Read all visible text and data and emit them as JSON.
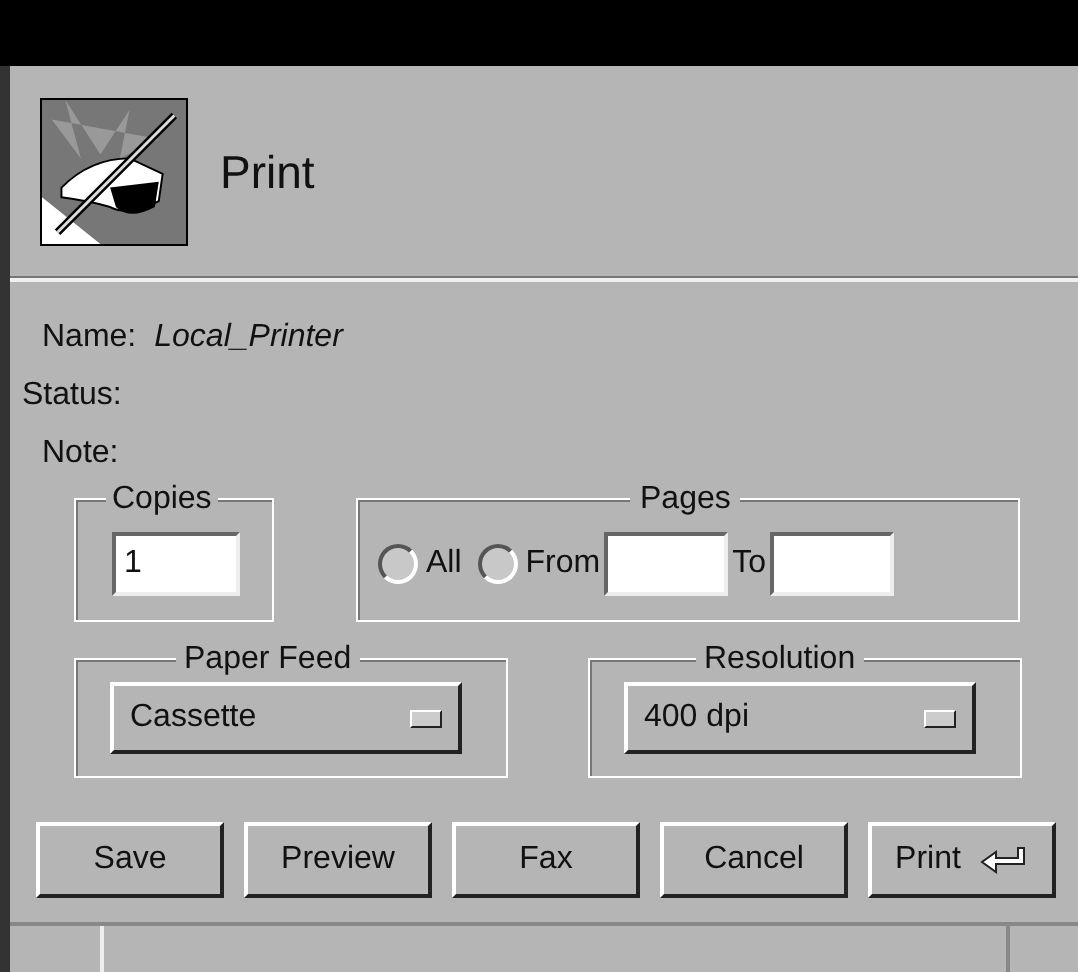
{
  "window": {
    "title": "Print"
  },
  "fields": [
    {
      "label": "Name:",
      "value": "Local_Printer"
    },
    {
      "label": "Status:"
    },
    {
      "label": "Note:"
    }
  ],
  "copies": {
    "label": "Copies",
    "value": "1"
  },
  "pages": {
    "label": "Pages",
    "options": [
      {
        "label": "All",
        "selected": false
      },
      {
        "label": "From",
        "selected": false
      }
    ],
    "to_label": "To"
  },
  "paper_feed": {
    "label": "Paper Feed",
    "value": "Cassette"
  },
  "resolution": {
    "label": "Resolution",
    "value": "400 dpi"
  },
  "buttons": [
    {
      "label": "Save",
      "default": false
    },
    {
      "label": "Preview",
      "default": false
    },
    {
      "label": "Fax",
      "default": false
    },
    {
      "label": "Cancel",
      "default": false
    },
    {
      "label": "Print",
      "default": true
    }
  ]
}
